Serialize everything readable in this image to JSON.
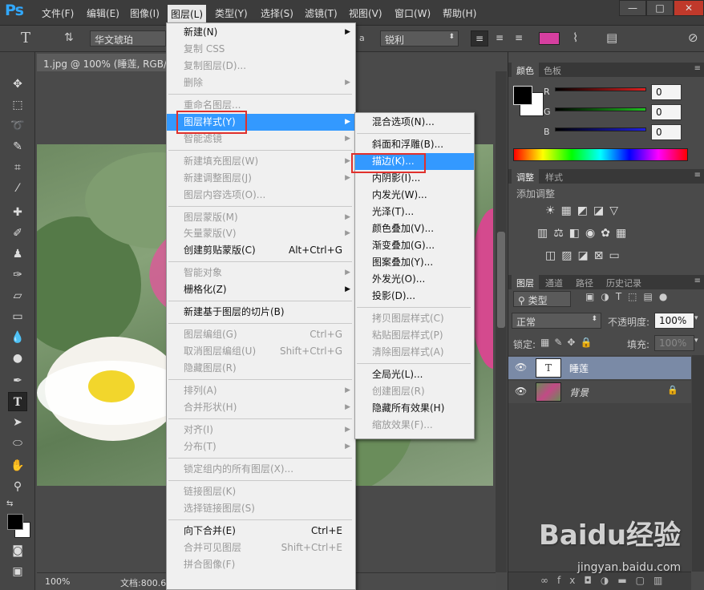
{
  "app": {
    "logo": "Ps"
  },
  "menubar": {
    "items": [
      "文件(F)",
      "编辑(E)",
      "图像(I)",
      "图层(L)",
      "类型(Y)",
      "选择(S)",
      "滤镜(T)",
      "视图(V)",
      "窗口(W)",
      "帮助(H)"
    ],
    "active": "图层(L)"
  },
  "window_controls": {
    "minimize": "—",
    "maximize": "□",
    "close": "✕"
  },
  "options": {
    "font_family": "华文琥珀",
    "antialias_prefix": "a",
    "antialias": "锐利",
    "color": "#d63fa0"
  },
  "document": {
    "tab_title": "1.jpg @ 100% (睡莲, RGB/8",
    "zoom": "100%",
    "doc_info": "文档:800.6"
  },
  "layer_menu": {
    "items": [
      {
        "label": "新建(N)",
        "sub": true
      },
      {
        "label": "复制 CSS",
        "disabled": true
      },
      {
        "label": "复制图层(D)...",
        "disabled": true
      },
      {
        "label": "删除",
        "disabled": true,
        "sub": true
      },
      {
        "sep": true
      },
      {
        "label": "重命名图层...",
        "disabled": true
      },
      {
        "label": "图层样式(Y)",
        "sub": true,
        "highlight": true
      },
      {
        "label": "智能滤镜",
        "disabled": true,
        "sub": true
      },
      {
        "sep": true
      },
      {
        "label": "新建填充图层(W)",
        "disabled": true,
        "sub": true
      },
      {
        "label": "新建调整图层(J)",
        "disabled": true,
        "sub": true
      },
      {
        "label": "图层内容选项(O)...",
        "disabled": true
      },
      {
        "sep": true
      },
      {
        "label": "图层蒙版(M)",
        "disabled": true,
        "sub": true
      },
      {
        "label": "矢量蒙版(V)",
        "disabled": true,
        "sub": true
      },
      {
        "label": "创建剪贴蒙版(C)",
        "shortcut": "Alt+Ctrl+G"
      },
      {
        "sep": true
      },
      {
        "label": "智能对象",
        "disabled": true,
        "sub": true
      },
      {
        "label": "栅格化(Z)",
        "sub": true
      },
      {
        "sep": true
      },
      {
        "label": "新建基于图层的切片(B)"
      },
      {
        "sep": true
      },
      {
        "label": "图层编组(G)",
        "disabled": true,
        "shortcut": "Ctrl+G"
      },
      {
        "label": "取消图层编组(U)",
        "disabled": true,
        "shortcut": "Shift+Ctrl+G"
      },
      {
        "label": "隐藏图层(R)",
        "disabled": true
      },
      {
        "sep": true
      },
      {
        "label": "排列(A)",
        "disabled": true,
        "sub": true
      },
      {
        "label": "合并形状(H)",
        "disabled": true,
        "sub": true
      },
      {
        "sep": true
      },
      {
        "label": "对齐(I)",
        "disabled": true,
        "sub": true
      },
      {
        "label": "分布(T)",
        "disabled": true,
        "sub": true
      },
      {
        "sep": true
      },
      {
        "label": "锁定组内的所有图层(X)...",
        "disabled": true
      },
      {
        "sep": true
      },
      {
        "label": "链接图层(K)",
        "disabled": true
      },
      {
        "label": "选择链接图层(S)",
        "disabled": true
      },
      {
        "sep": true
      },
      {
        "label": "向下合并(E)",
        "shortcut": "Ctrl+E"
      },
      {
        "label": "合并可见图层",
        "disabled": true,
        "shortcut": "Shift+Ctrl+E"
      },
      {
        "label": "拼合图像(F)",
        "disabled": true
      }
    ]
  },
  "style_submenu": {
    "items": [
      {
        "label": "混合选项(N)..."
      },
      {
        "sep": true
      },
      {
        "label": "斜面和浮雕(B)..."
      },
      {
        "label": "描边(K)...",
        "highlight": true
      },
      {
        "label": "内阴影(I)..."
      },
      {
        "label": "内发光(W)..."
      },
      {
        "label": "光泽(T)..."
      },
      {
        "label": "颜色叠加(V)..."
      },
      {
        "label": "渐变叠加(G)..."
      },
      {
        "label": "图案叠加(Y)..."
      },
      {
        "label": "外发光(O)..."
      },
      {
        "label": "投影(D)..."
      },
      {
        "sep": true
      },
      {
        "label": "拷贝图层样式(C)",
        "disabled": true
      },
      {
        "label": "粘贴图层样式(P)",
        "disabled": true
      },
      {
        "label": "清除图层样式(A)",
        "disabled": true
      },
      {
        "sep": true
      },
      {
        "label": "全局光(L)..."
      },
      {
        "label": "创建图层(R)",
        "disabled": true
      },
      {
        "label": "隐藏所有效果(H)"
      },
      {
        "label": "缩放效果(F)...",
        "disabled": true
      }
    ]
  },
  "color_panel": {
    "tabs": [
      "颜色",
      "色板"
    ],
    "channels": [
      {
        "name": "R",
        "value": "0",
        "color": "#e02020"
      },
      {
        "name": "G",
        "value": "0",
        "color": "#20c020"
      },
      {
        "name": "B",
        "value": "0",
        "color": "#2020e0"
      }
    ]
  },
  "adjust_panel": {
    "tabs": [
      "调整",
      "样式"
    ],
    "title": "添加调整"
  },
  "layers_panel": {
    "tabs": [
      "图层",
      "通道",
      "路径",
      "历史记录"
    ],
    "filter": "类型",
    "blend_mode": "正常",
    "opacity_label": "不透明度:",
    "opacity": "100%",
    "lock_label": "锁定:",
    "fill_label": "填充:",
    "fill": "100%",
    "layers": [
      {
        "name": "睡莲",
        "type": "text",
        "thumb": "T",
        "selected": true
      },
      {
        "name": "背景",
        "type": "image",
        "locked": true
      }
    ]
  },
  "watermark": {
    "brand": "Baidu经验",
    "url": "jingyan.baidu.com"
  }
}
